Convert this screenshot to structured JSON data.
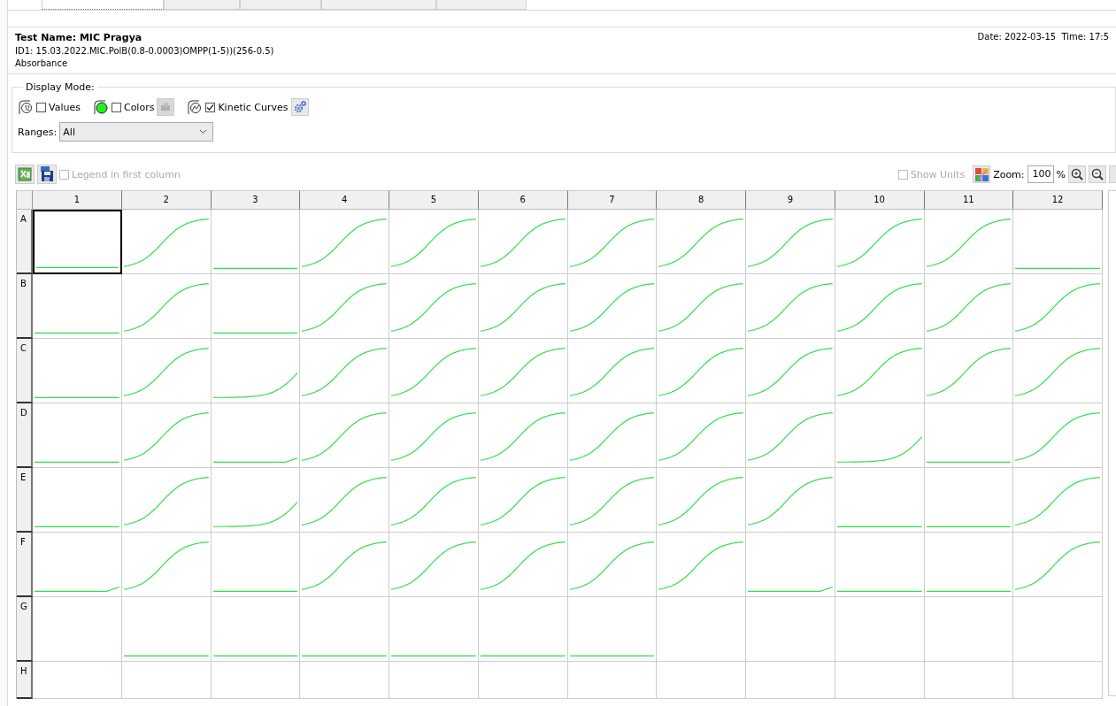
{
  "tabs": [
    {
      "selected": true
    },
    {
      "selected": false
    },
    {
      "selected": false
    },
    {
      "selected": false
    },
    {
      "selected": false
    }
  ],
  "header": {
    "test_name": "Test Name: MIC Pragya",
    "id": "ID1: 15.03.2022.MIC.PolB(0.8-0.0003)OMPP(1-5))(256-0.5)",
    "measurement": "Absorbance",
    "datetime": "Date: 2022-03-15  Time: 17:5"
  },
  "display_mode": {
    "title": "Display Mode:",
    "options": [
      {
        "kind": "values",
        "label": "Values",
        "checked": false
      },
      {
        "kind": "colors",
        "label": "Colors",
        "checked": false
      },
      {
        "kind": "kinetic",
        "label": "Kinetic Curves",
        "checked": true
      }
    ],
    "ranges_label": "Ranges:",
    "ranges_value": "All"
  },
  "toolbar": {
    "legend": {
      "label": "Legend in first column",
      "checked": false,
      "disabled": true
    },
    "show_units": {
      "label": "Show Units",
      "checked": false,
      "disabled": true
    },
    "zoom_label": "Zoom:",
    "zoom_value": "100",
    "zoom_unit": "%"
  },
  "plate": {
    "columns": [
      "1",
      "2",
      "3",
      "4",
      "5",
      "6",
      "7",
      "8",
      "9",
      "10",
      "11",
      "12"
    ],
    "rows": [
      {
        "label": "A",
        "wells": [
          {
            "kind": "flat",
            "selected": true
          },
          {
            "kind": "sigmoid",
            "selected": false
          },
          {
            "kind": "flat",
            "selected": false
          },
          {
            "kind": "sigmoid",
            "selected": false
          },
          {
            "kind": "sigmoid",
            "selected": false
          },
          {
            "kind": "sigmoid",
            "selected": false
          },
          {
            "kind": "sigmoid",
            "selected": false
          },
          {
            "kind": "sigmoid",
            "selected": false
          },
          {
            "kind": "sigmoid",
            "selected": false
          },
          {
            "kind": "sigmoid",
            "selected": false
          },
          {
            "kind": "sigmoid",
            "selected": false
          },
          {
            "kind": "flat",
            "selected": false
          }
        ]
      },
      {
        "label": "B",
        "wells": [
          {
            "kind": "flat",
            "selected": false
          },
          {
            "kind": "sigmoid",
            "selected": false
          },
          {
            "kind": "flat",
            "selected": false
          },
          {
            "kind": "sigmoid",
            "selected": false
          },
          {
            "kind": "sigmoid",
            "selected": false
          },
          {
            "kind": "sigmoid",
            "selected": false
          },
          {
            "kind": "sigmoid",
            "selected": false
          },
          {
            "kind": "sigmoid",
            "selected": false
          },
          {
            "kind": "sigmoid",
            "selected": false
          },
          {
            "kind": "sigmoid",
            "selected": false
          },
          {
            "kind": "sigmoid",
            "selected": false
          },
          {
            "kind": "sigmoid",
            "selected": false
          }
        ]
      },
      {
        "label": "C",
        "wells": [
          {
            "kind": "flat",
            "selected": false
          },
          {
            "kind": "sigmoid",
            "selected": false
          },
          {
            "kind": "late",
            "selected": false
          },
          {
            "kind": "sigmoid",
            "selected": false
          },
          {
            "kind": "sigmoid",
            "selected": false
          },
          {
            "kind": "sigmoid",
            "selected": false
          },
          {
            "kind": "sigmoid",
            "selected": false
          },
          {
            "kind": "sigmoid",
            "selected": false
          },
          {
            "kind": "sigmoid",
            "selected": false
          },
          {
            "kind": "sigmoid",
            "selected": false
          },
          {
            "kind": "sigmoid",
            "selected": false
          },
          {
            "kind": "sigmoid",
            "selected": false
          }
        ]
      },
      {
        "label": "D",
        "wells": [
          {
            "kind": "flat",
            "selected": false
          },
          {
            "kind": "sigmoid",
            "selected": false
          },
          {
            "kind": "tail",
            "selected": false
          },
          {
            "kind": "sigmoid",
            "selected": false
          },
          {
            "kind": "sigmoid",
            "selected": false
          },
          {
            "kind": "sigmoid",
            "selected": false
          },
          {
            "kind": "sigmoid",
            "selected": false
          },
          {
            "kind": "sigmoid",
            "selected": false
          },
          {
            "kind": "sigmoid",
            "selected": false
          },
          {
            "kind": "late",
            "selected": false
          },
          {
            "kind": "flat",
            "selected": false
          },
          {
            "kind": "sigmoid",
            "selected": false
          }
        ]
      },
      {
        "label": "E",
        "wells": [
          {
            "kind": "flat",
            "selected": false
          },
          {
            "kind": "sigmoid",
            "selected": false
          },
          {
            "kind": "late",
            "selected": false
          },
          {
            "kind": "sigmoid",
            "selected": false
          },
          {
            "kind": "sigmoid",
            "selected": false
          },
          {
            "kind": "sigmoid",
            "selected": false
          },
          {
            "kind": "sigmoid",
            "selected": false
          },
          {
            "kind": "sigmoid",
            "selected": false
          },
          {
            "kind": "sigmoid",
            "selected": false
          },
          {
            "kind": "flat",
            "selected": false
          },
          {
            "kind": "flat",
            "selected": false
          },
          {
            "kind": "sigmoid",
            "selected": false
          }
        ]
      },
      {
        "label": "F",
        "wells": [
          {
            "kind": "tail",
            "selected": false
          },
          {
            "kind": "sigmoid",
            "selected": false
          },
          {
            "kind": "flat",
            "selected": false
          },
          {
            "kind": "sigmoid",
            "selected": false
          },
          {
            "kind": "sigmoid",
            "selected": false
          },
          {
            "kind": "sigmoid",
            "selected": false
          },
          {
            "kind": "sigmoid",
            "selected": false
          },
          {
            "kind": "sigmoid",
            "selected": false
          },
          {
            "kind": "tail",
            "selected": false
          },
          {
            "kind": "flat",
            "selected": false
          },
          {
            "kind": "flat",
            "selected": false
          },
          {
            "kind": "sigmoid",
            "selected": false
          }
        ]
      },
      {
        "label": "G",
        "wells": [
          {
            "kind": "empty",
            "selected": false
          },
          {
            "kind": "flat",
            "selected": false
          },
          {
            "kind": "flat",
            "selected": false
          },
          {
            "kind": "flat",
            "selected": false
          },
          {
            "kind": "flat",
            "selected": false
          },
          {
            "kind": "flat",
            "selected": false
          },
          {
            "kind": "flat",
            "selected": false
          },
          {
            "kind": "empty",
            "selected": false
          },
          {
            "kind": "empty",
            "selected": false
          },
          {
            "kind": "empty",
            "selected": false
          },
          {
            "kind": "empty",
            "selected": false
          },
          {
            "kind": "empty",
            "selected": false
          }
        ]
      },
      {
        "label": "H",
        "wells": [
          {
            "kind": "empty",
            "selected": false
          },
          {
            "kind": "empty",
            "selected": false
          },
          {
            "kind": "empty",
            "selected": false
          },
          {
            "kind": "empty",
            "selected": false
          },
          {
            "kind": "empty",
            "selected": false
          },
          {
            "kind": "empty",
            "selected": false
          },
          {
            "kind": "empty",
            "selected": false
          },
          {
            "kind": "empty",
            "selected": false
          },
          {
            "kind": "empty",
            "selected": false
          },
          {
            "kind": "empty",
            "selected": false
          },
          {
            "kind": "empty",
            "selected": false
          },
          {
            "kind": "empty",
            "selected": false
          }
        ]
      }
    ]
  }
}
